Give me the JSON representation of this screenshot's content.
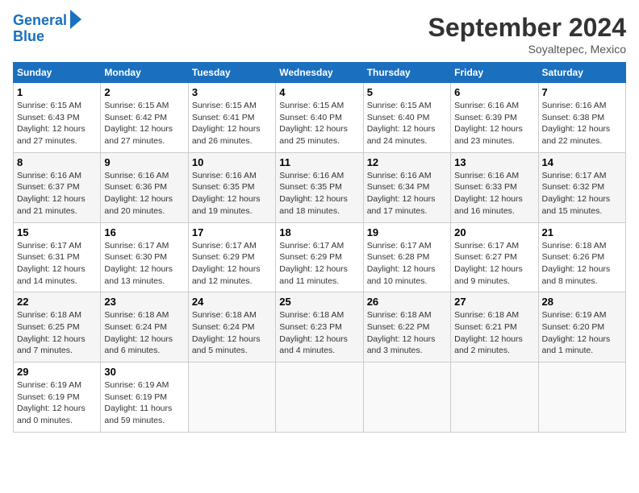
{
  "logo": {
    "line1": "General",
    "line2": "Blue"
  },
  "title": "September 2024",
  "subtitle": "Soyaltepec, Mexico",
  "days_of_week": [
    "Sunday",
    "Monday",
    "Tuesday",
    "Wednesday",
    "Thursday",
    "Friday",
    "Saturday"
  ],
  "weeks": [
    [
      {
        "day": "1",
        "sunrise": "6:15 AM",
        "sunset": "6:43 PM",
        "daylight": "Daylight: 12 hours and 27 minutes."
      },
      {
        "day": "2",
        "sunrise": "6:15 AM",
        "sunset": "6:42 PM",
        "daylight": "Daylight: 12 hours and 27 minutes."
      },
      {
        "day": "3",
        "sunrise": "6:15 AM",
        "sunset": "6:41 PM",
        "daylight": "Daylight: 12 hours and 26 minutes."
      },
      {
        "day": "4",
        "sunrise": "6:15 AM",
        "sunset": "6:40 PM",
        "daylight": "Daylight: 12 hours and 25 minutes."
      },
      {
        "day": "5",
        "sunrise": "6:15 AM",
        "sunset": "6:40 PM",
        "daylight": "Daylight: 12 hours and 24 minutes."
      },
      {
        "day": "6",
        "sunrise": "6:16 AM",
        "sunset": "6:39 PM",
        "daylight": "Daylight: 12 hours and 23 minutes."
      },
      {
        "day": "7",
        "sunrise": "6:16 AM",
        "sunset": "6:38 PM",
        "daylight": "Daylight: 12 hours and 22 minutes."
      }
    ],
    [
      {
        "day": "8",
        "sunrise": "6:16 AM",
        "sunset": "6:37 PM",
        "daylight": "Daylight: 12 hours and 21 minutes."
      },
      {
        "day": "9",
        "sunrise": "6:16 AM",
        "sunset": "6:36 PM",
        "daylight": "Daylight: 12 hours and 20 minutes."
      },
      {
        "day": "10",
        "sunrise": "6:16 AM",
        "sunset": "6:35 PM",
        "daylight": "Daylight: 12 hours and 19 minutes."
      },
      {
        "day": "11",
        "sunrise": "6:16 AM",
        "sunset": "6:35 PM",
        "daylight": "Daylight: 12 hours and 18 minutes."
      },
      {
        "day": "12",
        "sunrise": "6:16 AM",
        "sunset": "6:34 PM",
        "daylight": "Daylight: 12 hours and 17 minutes."
      },
      {
        "day": "13",
        "sunrise": "6:16 AM",
        "sunset": "6:33 PM",
        "daylight": "Daylight: 12 hours and 16 minutes."
      },
      {
        "day": "14",
        "sunrise": "6:17 AM",
        "sunset": "6:32 PM",
        "daylight": "Daylight: 12 hours and 15 minutes."
      }
    ],
    [
      {
        "day": "15",
        "sunrise": "6:17 AM",
        "sunset": "6:31 PM",
        "daylight": "Daylight: 12 hours and 14 minutes."
      },
      {
        "day": "16",
        "sunrise": "6:17 AM",
        "sunset": "6:30 PM",
        "daylight": "Daylight: 12 hours and 13 minutes."
      },
      {
        "day": "17",
        "sunrise": "6:17 AM",
        "sunset": "6:29 PM",
        "daylight": "Daylight: 12 hours and 12 minutes."
      },
      {
        "day": "18",
        "sunrise": "6:17 AM",
        "sunset": "6:29 PM",
        "daylight": "Daylight: 12 hours and 11 minutes."
      },
      {
        "day": "19",
        "sunrise": "6:17 AM",
        "sunset": "6:28 PM",
        "daylight": "Daylight: 12 hours and 10 minutes."
      },
      {
        "day": "20",
        "sunrise": "6:17 AM",
        "sunset": "6:27 PM",
        "daylight": "Daylight: 12 hours and 9 minutes."
      },
      {
        "day": "21",
        "sunrise": "6:18 AM",
        "sunset": "6:26 PM",
        "daylight": "Daylight: 12 hours and 8 minutes."
      }
    ],
    [
      {
        "day": "22",
        "sunrise": "6:18 AM",
        "sunset": "6:25 PM",
        "daylight": "Daylight: 12 hours and 7 minutes."
      },
      {
        "day": "23",
        "sunrise": "6:18 AM",
        "sunset": "6:24 PM",
        "daylight": "Daylight: 12 hours and 6 minutes."
      },
      {
        "day": "24",
        "sunrise": "6:18 AM",
        "sunset": "6:24 PM",
        "daylight": "Daylight: 12 hours and 5 minutes."
      },
      {
        "day": "25",
        "sunrise": "6:18 AM",
        "sunset": "6:23 PM",
        "daylight": "Daylight: 12 hours and 4 minutes."
      },
      {
        "day": "26",
        "sunrise": "6:18 AM",
        "sunset": "6:22 PM",
        "daylight": "Daylight: 12 hours and 3 minutes."
      },
      {
        "day": "27",
        "sunrise": "6:18 AM",
        "sunset": "6:21 PM",
        "daylight": "Daylight: 12 hours and 2 minutes."
      },
      {
        "day": "28",
        "sunrise": "6:19 AM",
        "sunset": "6:20 PM",
        "daylight": "Daylight: 12 hours and 1 minute."
      }
    ],
    [
      {
        "day": "29",
        "sunrise": "6:19 AM",
        "sunset": "6:19 PM",
        "daylight": "Daylight: 12 hours and 0 minutes."
      },
      {
        "day": "30",
        "sunrise": "6:19 AM",
        "sunset": "6:19 PM",
        "daylight": "Daylight: 11 hours and 59 minutes."
      },
      null,
      null,
      null,
      null,
      null
    ]
  ]
}
